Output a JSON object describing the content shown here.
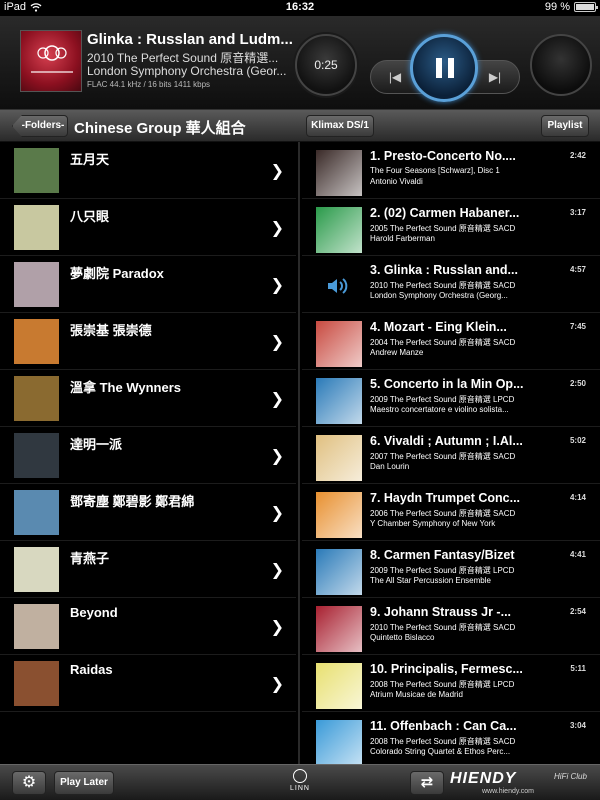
{
  "status": {
    "device": "iPad",
    "time": "16:32",
    "battery": "99 %"
  },
  "now_playing": {
    "title": "Glinka : Russlan and Ludm...",
    "album": "2010 The Perfect Sound 原音精選...",
    "artist": "London Symphony Orchestra (Geor...",
    "format": "FLAC   44.1 kHz / 16 bits   1411 kbps",
    "elapsed": "0:25"
  },
  "toolbar": {
    "back_label": "-Folders-",
    "title": "Chinese Group 華人組合",
    "device_label": "Klimax DS/1",
    "playlist_label": "Playlist"
  },
  "groups": [
    {
      "label": "五月天",
      "color": "#5a7a4a"
    },
    {
      "label": "八只眼",
      "color": "#c8c8a0"
    },
    {
      "label": "夢劇院 Paradox",
      "color": "#b0a0a8"
    },
    {
      "label": "張崇基  張崇德",
      "color": "#c87a30"
    },
    {
      "label": "溫拿 The Wynners",
      "color": "#8a6a30"
    },
    {
      "label": "達明一派",
      "color": "#303840"
    },
    {
      "label": "鄧寄塵  鄭碧影  鄭君綿",
      "color": "#5a8ab0"
    },
    {
      "label": "青燕子",
      "color": "#d8d8c0"
    },
    {
      "label": "Beyond",
      "color": "#c0b0a0"
    },
    {
      "label": "Raidas",
      "color": "#8a5030"
    }
  ],
  "tracks": [
    {
      "title": "1. Presto-Concerto No....",
      "duration": "2:42",
      "album": "The Four Seasons [Schwarz], Disc 1",
      "artist": "Antonio Vivaldi",
      "color": "#3a2a28"
    },
    {
      "title": "2. (02) Carmen Habaner...",
      "duration": "3:17",
      "album": "2005 The Perfect Sound 原音精選 SACD",
      "artist": "Harold Farberman",
      "color": "#2a9a4a"
    },
    {
      "title": "3. Glinka : Russlan and...",
      "duration": "4:57",
      "album": "2010 The Perfect Sound 原音精選 SACD",
      "artist": "London Symphony Orchestra (Georg...",
      "color": "",
      "playing": true
    },
    {
      "title": "4. Mozart - Eing Klein...",
      "duration": "7:45",
      "album": "2004 The Perfect Sound 原音精選 SACD",
      "artist": "Andrew Manze",
      "color": "#c84a40"
    },
    {
      "title": "5. Concerto in la Min Op...",
      "duration": "2:50",
      "album": "2009 The Perfect Sound 原音精選 LPCD",
      "artist": "Maestro concertatore e violino solista...",
      "color": "#2a7ab8"
    },
    {
      "title": "6. Vivaldi ; Autumn ; I.Al...",
      "duration": "5:02",
      "album": "2007 The Perfect Sound 原音精選 SACD",
      "artist": "Dan Lourin",
      "color": "#e0c080"
    },
    {
      "title": "7. Haydn Trumpet Conc...",
      "duration": "4:14",
      "album": "2006 The Perfect Sound 原音精選 SACD",
      "artist": "Y Chamber Symphony of New York",
      "color": "#e89030"
    },
    {
      "title": "8. Carmen Fantasy/Bizet",
      "duration": "4:41",
      "album": "2009 The Perfect Sound 原音精選 LPCD",
      "artist": "The All Star Percussion Ensemble",
      "color": "#2a7ab8"
    },
    {
      "title": "9. Johann Strauss Jr -...",
      "duration": "2:54",
      "album": "2010 The Perfect Sound 原音精選 SACD",
      "artist": "Quintetto Bislacco",
      "color": "#a82030"
    },
    {
      "title": "10. Principalis, Fermesc...",
      "duration": "5:11",
      "album": "2008 The Perfect Sound 原音精選 LPCD",
      "artist": "Atrium Musicae de Madrid",
      "color": "#e8e070"
    },
    {
      "title": "11. Offenbach : Can Ca...",
      "duration": "3:04",
      "album": "2008 The Perfect Sound 原音精選 SACD",
      "artist": "Colorado String Quartet & Ethos Perc...",
      "color": "#3a9ad8"
    }
  ],
  "bottom": {
    "play_later_label": "Play Later",
    "brand": "LINN",
    "watermark": "HIENDY",
    "watermark_sub": "HiFi Club",
    "watermark_url": "www.hiendy.com"
  }
}
